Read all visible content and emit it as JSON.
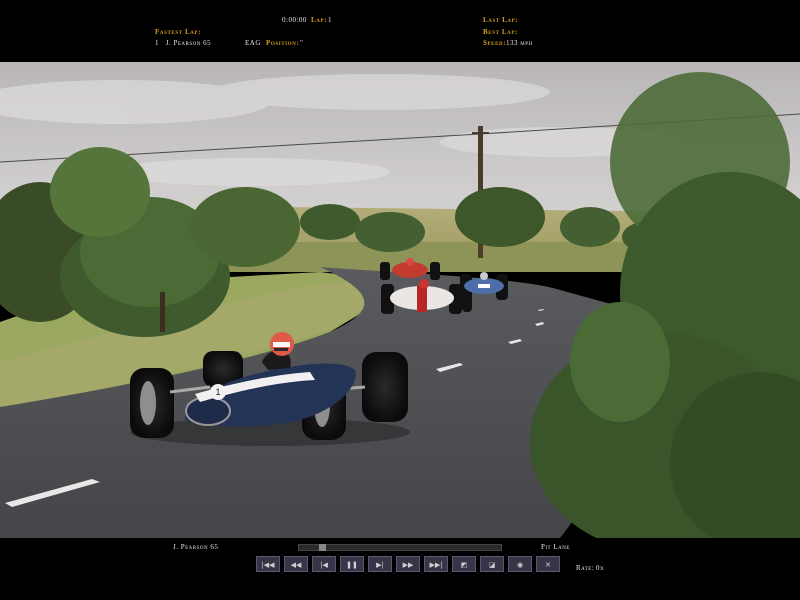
{
  "hud": {
    "fastest_lap_label": "Fastest Lap:",
    "fastest_lap_value": "1   J. Pearson 65",
    "team_abbr": "EAG",
    "position_label": "Position:",
    "position_value": "\"",
    "timer": "0:00:00",
    "lap_label": "Lap:",
    "lap_value": "1",
    "last_lap_label": "Last Lap:",
    "best_lap_label": "Best Lap:",
    "speed_label": "Speed:",
    "speed_value": "133 mph"
  },
  "replay": {
    "driver": "J. Pearson 65",
    "camera": "Pit Lane",
    "rate_label": "Rate:",
    "rate_value": "0x",
    "progress": 0.1,
    "buttons": [
      {
        "name": "skip-start-button",
        "glyph": "|◀◀"
      },
      {
        "name": "fast-rewind-button",
        "glyph": "◀◀"
      },
      {
        "name": "rewind-button",
        "glyph": "|◀"
      },
      {
        "name": "pause-button",
        "glyph": "❚❚"
      },
      {
        "name": "play-button",
        "glyph": "▶|"
      },
      {
        "name": "forward-button",
        "glyph": "▶▶"
      },
      {
        "name": "skip-end-button",
        "glyph": "▶▶|"
      },
      {
        "name": "camera-button",
        "glyph": "◩"
      },
      {
        "name": "view-button",
        "glyph": "◪"
      },
      {
        "name": "record-button",
        "glyph": "◉"
      },
      {
        "name": "exit-button",
        "glyph": "✕"
      }
    ]
  },
  "scene": {
    "car_number": "1"
  },
  "colors": {
    "hud_label": "#d6a21e",
    "hud_value": "#e8e8e8",
    "control_bg": "#3a3448"
  }
}
